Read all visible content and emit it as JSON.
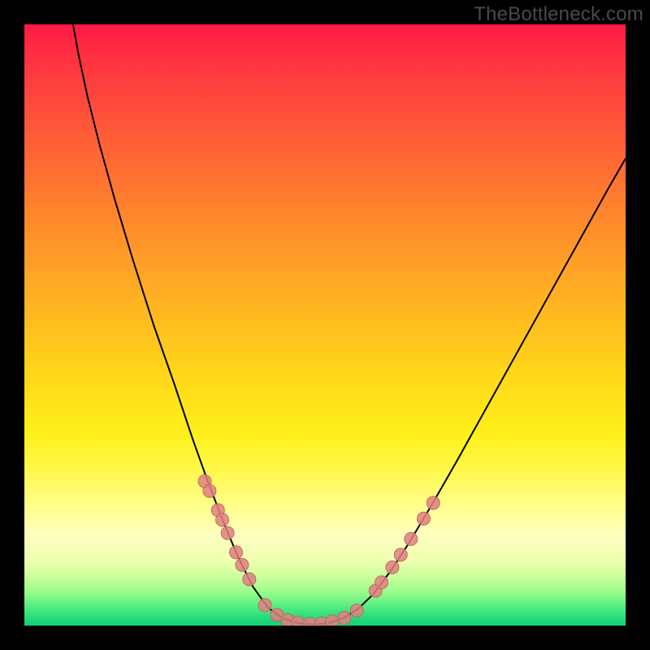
{
  "watermark": "TheBottleneck.com",
  "chart_data": {
    "type": "line",
    "title": "",
    "xlabel": "",
    "ylabel": "",
    "xlim": [
      0,
      100
    ],
    "ylim": [
      0,
      100
    ],
    "grid": false,
    "curve_points": [
      {
        "x": 8.1,
        "y": 100
      },
      {
        "x": 9.0,
        "y": 95
      },
      {
        "x": 10.5,
        "y": 88
      },
      {
        "x": 12.5,
        "y": 80
      },
      {
        "x": 15.0,
        "y": 71
      },
      {
        "x": 18.0,
        "y": 61
      },
      {
        "x": 21.5,
        "y": 50
      },
      {
        "x": 25.0,
        "y": 40
      },
      {
        "x": 28.0,
        "y": 31
      },
      {
        "x": 30.5,
        "y": 24
      },
      {
        "x": 33.0,
        "y": 17.5
      },
      {
        "x": 35.5,
        "y": 11.5
      },
      {
        "x": 38.0,
        "y": 6.5
      },
      {
        "x": 40.5,
        "y": 3.0
      },
      {
        "x": 43.0,
        "y": 1.2
      },
      {
        "x": 45.5,
        "y": 0.4
      },
      {
        "x": 48.0,
        "y": 0.2
      },
      {
        "x": 50.5,
        "y": 0.4
      },
      {
        "x": 53.0,
        "y": 1.2
      },
      {
        "x": 55.5,
        "y": 2.8
      },
      {
        "x": 58.0,
        "y": 5.2
      },
      {
        "x": 61.0,
        "y": 9.2
      },
      {
        "x": 64.0,
        "y": 13.8
      },
      {
        "x": 68.0,
        "y": 20.5
      },
      {
        "x": 72.0,
        "y": 27.5
      },
      {
        "x": 77.0,
        "y": 36.5
      },
      {
        "x": 82.0,
        "y": 45.5
      },
      {
        "x": 87.0,
        "y": 54.5
      },
      {
        "x": 92.0,
        "y": 63.5
      },
      {
        "x": 97.0,
        "y": 72.5
      },
      {
        "x": 100.0,
        "y": 77.7
      }
    ],
    "marker_clusters": [
      {
        "side": "left",
        "x_range": [
          30,
          38
        ],
        "y_range": [
          8,
          24
        ],
        "count": 8
      },
      {
        "side": "bottom",
        "x_range": [
          40,
          56
        ],
        "y_range": [
          0.2,
          3.2
        ],
        "count": 9
      },
      {
        "side": "right",
        "x_range": [
          58,
          68
        ],
        "y_range": [
          6,
          22
        ],
        "count": 7
      }
    ],
    "markers": [
      {
        "x": 30.0,
        "y": 24.0
      },
      {
        "x": 30.8,
        "y": 22.4
      },
      {
        "x": 32.2,
        "y": 19.2
      },
      {
        "x": 32.9,
        "y": 17.6
      },
      {
        "x": 33.8,
        "y": 15.4
      },
      {
        "x": 35.2,
        "y": 12.2
      },
      {
        "x": 36.2,
        "y": 10.1
      },
      {
        "x": 37.4,
        "y": 7.7
      },
      {
        "x": 40.0,
        "y": 3.4
      },
      {
        "x": 42.0,
        "y": 1.8
      },
      {
        "x": 43.8,
        "y": 0.9
      },
      {
        "x": 45.5,
        "y": 0.5
      },
      {
        "x": 47.5,
        "y": 0.3
      },
      {
        "x": 49.4,
        "y": 0.4
      },
      {
        "x": 51.2,
        "y": 0.7
      },
      {
        "x": 53.2,
        "y": 1.3
      },
      {
        "x": 55.3,
        "y": 2.5
      },
      {
        "x": 58.4,
        "y": 5.8
      },
      {
        "x": 59.4,
        "y": 7.2
      },
      {
        "x": 61.2,
        "y": 9.7
      },
      {
        "x": 62.6,
        "y": 11.8
      },
      {
        "x": 64.3,
        "y": 14.4
      },
      {
        "x": 66.4,
        "y": 17.8
      },
      {
        "x": 68.0,
        "y": 20.4
      }
    ],
    "colors": {
      "curve": "#000000",
      "marker_fill": "#e08080",
      "marker_stroke": "#c06868"
    }
  }
}
